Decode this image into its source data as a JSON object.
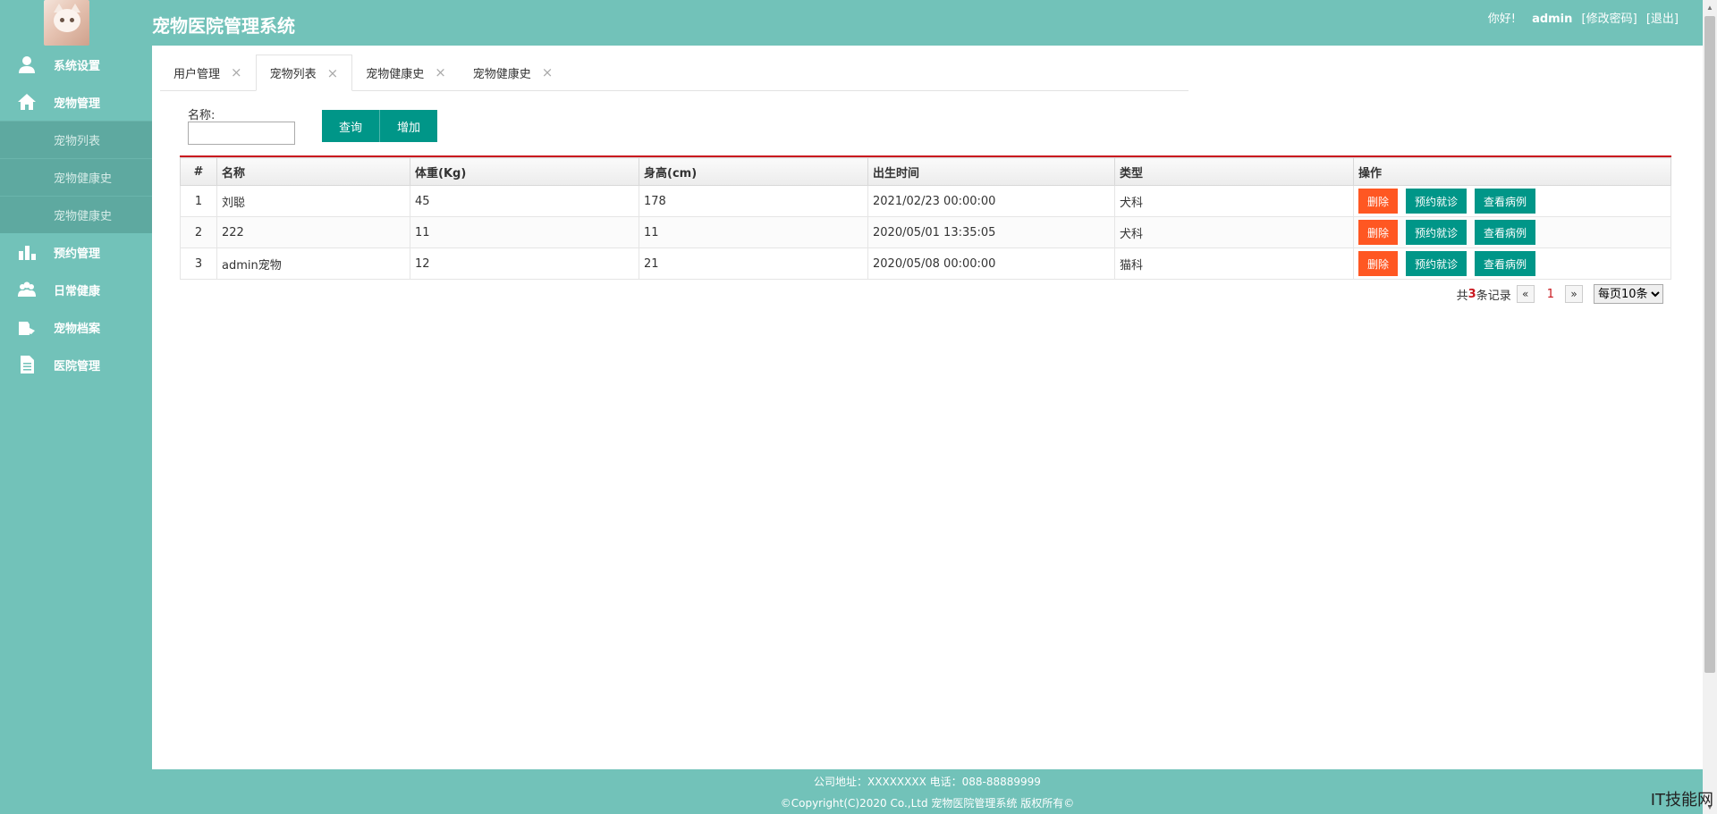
{
  "header": {
    "title": "宠物医院管理系统",
    "greeting": "你好!",
    "username": "admin",
    "change_password": "[修改密码]",
    "logout": "[退出]"
  },
  "sidebar": {
    "menu": [
      {
        "label": "系统设置",
        "icon": "user-icon"
      },
      {
        "label": "宠物管理",
        "icon": "home-icon"
      },
      {
        "label": "预约管理",
        "icon": "bar-chart-icon"
      },
      {
        "label": "日常健康",
        "icon": "group-icon"
      },
      {
        "label": "宠物档案",
        "icon": "pet-file-icon"
      },
      {
        "label": "医院管理",
        "icon": "document-icon"
      }
    ],
    "submenu": [
      "宠物列表",
      "宠物健康史",
      "宠物健康史"
    ]
  },
  "tabs": [
    {
      "label": "用户管理"
    },
    {
      "label": "宠物列表"
    },
    {
      "label": "宠物健康史"
    },
    {
      "label": "宠物健康史"
    }
  ],
  "tab_close": "×",
  "search": {
    "label": "名称:",
    "value": "",
    "query_button": "查询",
    "add_button": "增加"
  },
  "table": {
    "columns": [
      "#",
      "名称",
      "体重(Kg)",
      "身高(cm)",
      "出生时间",
      "类型",
      "操作"
    ],
    "rows": [
      {
        "idx": "1",
        "name": "刘聪",
        "weight": "45",
        "height": "178",
        "birth": "2021/02/23 00:00:00",
        "type": "犬科"
      },
      {
        "idx": "2",
        "name": "222",
        "weight": "11",
        "height": "11",
        "birth": "2020/05/01 13:35:05",
        "type": "犬科"
      },
      {
        "idx": "3",
        "name": "admin宠物",
        "weight": "12",
        "height": "21",
        "birth": "2020/05/08 00:00:00",
        "type": "猫科"
      }
    ],
    "actions": {
      "delete": "删除",
      "appointment": "预约就诊",
      "view_case": "查看病例"
    }
  },
  "pager": {
    "prefix": "共",
    "count": "3",
    "suffix": "条记录",
    "prev": "«",
    "current": "1",
    "next": "»",
    "per_page": "每页10条",
    "per_page_options": [
      "每页10条"
    ]
  },
  "footer": {
    "address": "公司地址：XXXXXXXX 电话：088-88889999",
    "copyright": "©Copyright(C)2020 Co.,Ltd 宠物医院管理系统 版权所有©"
  },
  "watermark": "IT技能网",
  "colors": {
    "theme": "#72c2b9",
    "primary": "#009688",
    "danger": "#ff5722",
    "accent_line": "#c9171e"
  }
}
